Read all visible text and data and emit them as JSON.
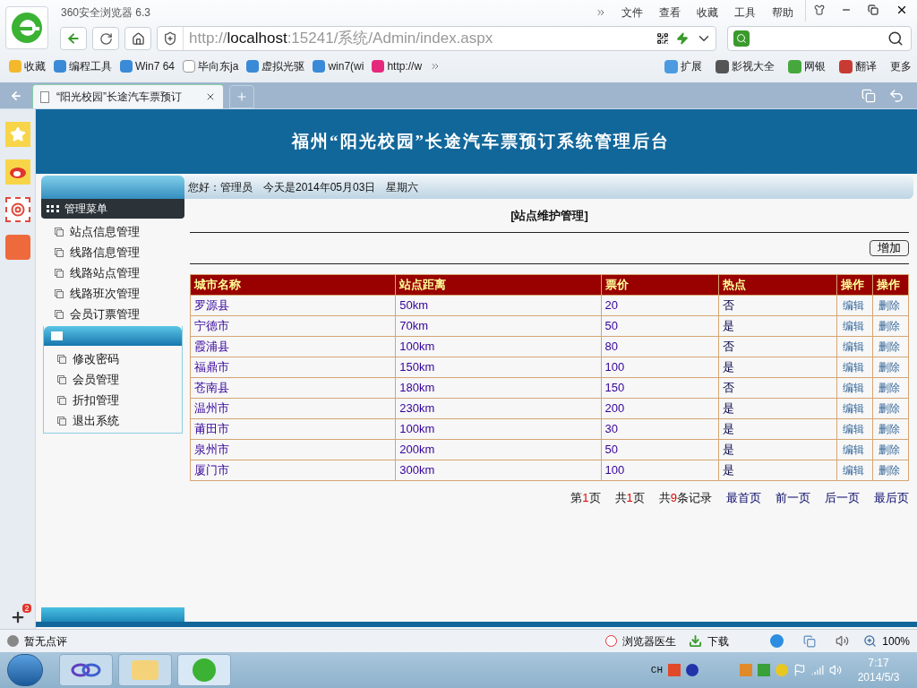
{
  "browser": {
    "title": "360安全浏览器 6.3",
    "menu": [
      "文件",
      "查看",
      "收藏",
      "工具",
      "帮助"
    ],
    "address": "http://**localhost**:15241/系统/Admin/index.aspx",
    "bookmarks": [
      "收藏",
      "编程工具",
      "Win7 64",
      "毕向东ja",
      "虚拟光驱",
      "win7(wi",
      "http://w"
    ],
    "toolbar_right": [
      "扩展",
      "影视大全",
      "网银",
      "翻译",
      "更多"
    ],
    "tabs": [
      {
        "title": "“阳光校园”长途汽车票预订",
        "selected": true
      }
    ],
    "badge": "2"
  },
  "page": {
    "title": "福州“阳光校园”长途汽车票预订系统管理后台",
    "greeting": [
      "您好：管理员",
      "今天是2014年05月03日",
      "星期六"
    ],
    "menu_sections": [
      {
        "title": "管理菜单",
        "items": [
          "站点信息管理",
          "线路信息管理",
          "线路站点管理",
          "线路班次管理",
          "会员订票管理"
        ]
      },
      {
        "items": [
          "修改密码",
          "会员管理",
          "折扣管理",
          "退出系统"
        ]
      }
    ],
    "heading": "[站点维护管理]",
    "add_button": "增加",
    "table": {
      "columns": [
        "城市名称",
        "站点距离",
        "票价",
        "热点",
        "操作",
        "操作"
      ],
      "rows": [
        {
          "city": "罗源县",
          "distance": "50km",
          "price": "20",
          "hot": "否",
          "edit": "编辑",
          "delete": "删除"
        },
        {
          "city": "宁德市",
          "distance": "70km",
          "price": "50",
          "hot": "是",
          "edit": "编辑",
          "delete": "删除"
        },
        {
          "city": "霞浦县",
          "distance": "100km",
          "price": "80",
          "hot": "否",
          "edit": "编辑",
          "delete": "删除"
        },
        {
          "city": "福鼎市",
          "distance": "150km",
          "price": "100",
          "hot": "是",
          "edit": "编辑",
          "delete": "删除"
        },
        {
          "city": "苍南县",
          "distance": "180km",
          "price": "150",
          "hot": "否",
          "edit": "编辑",
          "delete": "删除"
        },
        {
          "city": "温州市",
          "distance": "230km",
          "price": "200",
          "hot": "是",
          "edit": "编辑",
          "delete": "删除"
        },
        {
          "city": "莆田市",
          "distance": "100km",
          "price": "30",
          "hot": "是",
          "edit": "编辑",
          "delete": "删除"
        },
        {
          "city": "泉州市",
          "distance": "200km",
          "price": "50",
          "hot": "是",
          "edit": "编辑",
          "delete": "删除"
        },
        {
          "city": "厦门市",
          "distance": "300km",
          "price": "100",
          "hot": "是",
          "edit": "编辑",
          "delete": "删除"
        }
      ]
    },
    "pager": {
      "info": [
        {
          "prefix": "第",
          "value": "1",
          "suffix": "页"
        },
        {
          "prefix": "共",
          "value": "1",
          "suffix": "页"
        },
        {
          "prefix": "共",
          "value": "9",
          "suffix": "条记录"
        }
      ],
      "links": [
        "最首页",
        "前一页",
        "后一页",
        "最后页"
      ]
    }
  },
  "status_bar": {
    "rating": "暂无点评",
    "items": [
      "浏览器医生",
      "下载"
    ],
    "zoom": "100%"
  },
  "taskbar": {
    "language": "CH",
    "time": "7:17",
    "date": "2014/5/3"
  }
}
